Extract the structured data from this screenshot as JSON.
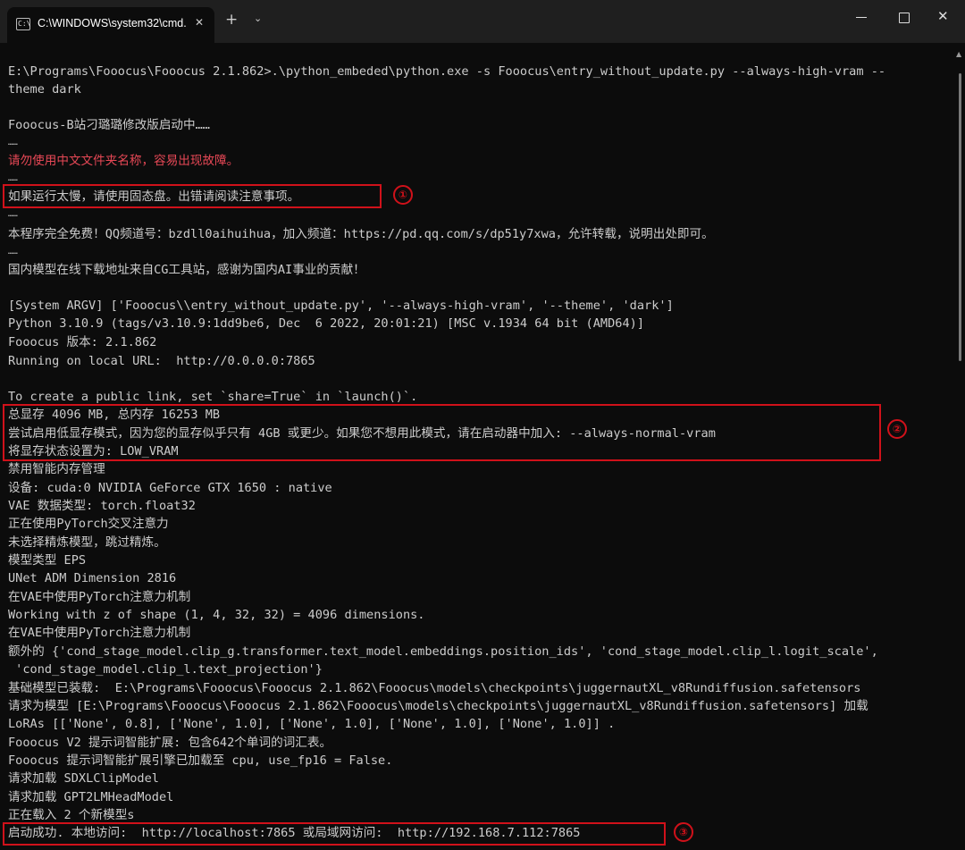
{
  "window": {
    "tab_title": "C:\\WINDOWS\\system32\\cmd.",
    "tab_icon": "C:\\",
    "tab_close": "✕",
    "new_tab": "+",
    "dropdown": "⌄",
    "close": "✕"
  },
  "terminal": {
    "lines": [
      "E:\\Programs\\Fooocus\\Fooocus 2.1.862>.\\python_embeded\\python.exe -s Fooocus\\entry_without_update.py --always-high-vram --",
      "theme dark",
      "",
      "Fooocus-B站刁璐璐修改版启动中……",
      "……",
      "请勿使用中文文件夹名称，容易出现故障。",
      "……",
      "如果运行太慢，请使用固态盘。出错请阅读注意事项。",
      "……",
      "本程序完全免费！QQ频道号：bzdll0aihuihua，加入频道：https://pd.qq.com/s/dp51y7xwa，允许转载，说明出处即可。",
      "……",
      "国内模型在线下载地址来自CG工具站，感谢为国内AI事业的贡献！",
      "",
      "[System ARGV] ['Fooocus\\\\entry_without_update.py', '--always-high-vram', '--theme', 'dark']",
      "Python 3.10.9 (tags/v3.10.9:1dd9be6, Dec  6 2022, 20:01:21) [MSC v.1934 64 bit (AMD64)]",
      "Fooocus 版本: 2.1.862",
      "Running on local URL:  http://0.0.0.0:7865",
      "",
      "To create a public link, set `share=True` in `launch()`.",
      "总显存 4096 MB, 总内存 16253 MB",
      "尝试启用低显存模式，因为您的显存似乎只有 4GB 或更少。如果您不想用此模式，请在启动器中加入: --always-normal-vram",
      "将显存状态设置为: LOW_VRAM",
      "禁用智能内存管理",
      "设备: cuda:0 NVIDIA GeForce GTX 1650 : native",
      "VAE 数据类型: torch.float32",
      "正在使用PyTorch交叉注意力",
      "未选择精炼模型，跳过精炼。",
      "模型类型 EPS",
      "UNet ADM Dimension 2816",
      "在VAE中使用PyTorch注意力机制",
      "Working with z of shape (1, 4, 32, 32) = 4096 dimensions.",
      "在VAE中使用PyTorch注意力机制",
      "额外的 {'cond_stage_model.clip_g.transformer.text_model.embeddings.position_ids', 'cond_stage_model.clip_l.logit_scale',",
      " 'cond_stage_model.clip_l.text_projection'}",
      "基础模型已装载:  E:\\Programs\\Fooocus\\Fooocus 2.1.862\\Fooocus\\models\\checkpoints\\juggernautXL_v8Rundiffusion.safetensors",
      "请求为模型 [E:\\Programs\\Fooocus\\Fooocus 2.1.862\\Fooocus\\models\\checkpoints\\juggernautXL_v8Rundiffusion.safetensors] 加载",
      "LoRAs [['None', 0.8], ['None', 1.0], ['None', 1.0], ['None', 1.0], ['None', 1.0]] .",
      "Fooocus V2 提示词智能扩展: 包含642个单词的词汇表。",
      "Fooocus 提示词智能扩展引擎已加载至 cpu, use_fp16 = False.",
      "请求加载 SDXLClipModel",
      "请求加载 GPT2LMHeadModel",
      "正在载入 2 个新模型s",
      "启动成功. 本地访问:  http://localhost:7865 或局域网访问:  http://192.168.7.112:7865"
    ]
  },
  "annotations": {
    "marker_1": "①",
    "marker_2": "②",
    "marker_3": "③"
  },
  "colors": {
    "background": "#0c0c0c",
    "text": "#cccccc",
    "warning_text": "#e74856",
    "highlight_box": "#d0111a"
  }
}
